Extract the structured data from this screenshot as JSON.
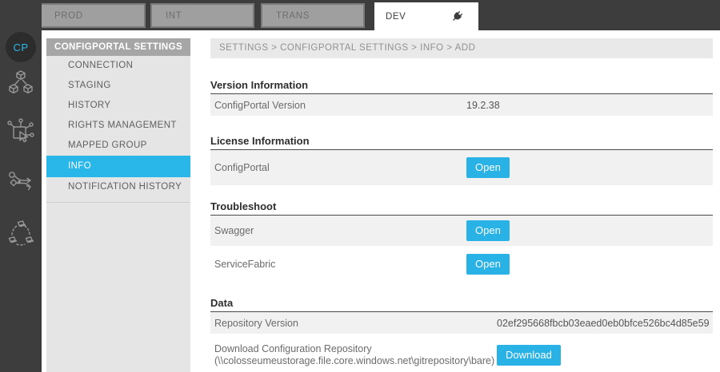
{
  "colors": {
    "accent": "#29b2e5",
    "topbar_dark": "#3d3d3d",
    "nav_selected": "#29b7ea",
    "tab_gray": "#9f9f9f",
    "row_shade": "#f1f1f1"
  },
  "sidebar": {
    "avatar_initials": "CP",
    "icons": [
      "cubes-icon",
      "touch-network-icon",
      "workflow-icon",
      "cluster-icon"
    ]
  },
  "tabs": [
    {
      "label": "PROD",
      "active": false
    },
    {
      "label": "INT",
      "active": false
    },
    {
      "label": "TRANS",
      "active": false
    },
    {
      "label": "DEV",
      "active": true,
      "icon": "plug-icon"
    }
  ],
  "nav": {
    "header": "CONFIGPORTAL SETTINGS",
    "items": [
      {
        "label": "CONNECTION",
        "selected": false
      },
      {
        "label": "STAGING",
        "selected": false
      },
      {
        "label": "HISTORY",
        "selected": false
      },
      {
        "label": "RIGHTS MANAGEMENT",
        "selected": false
      },
      {
        "label": "MAPPED GROUP",
        "selected": false
      },
      {
        "label": "INFO",
        "selected": true
      },
      {
        "label": "NOTIFICATION HISTORY",
        "selected": false
      }
    ]
  },
  "breadcrumb": "SETTINGS > CONFIGPORTAL SETTINGS > INFO > ADD",
  "sections": [
    {
      "title": "Version Information",
      "rows": [
        {
          "label": "ConfigPortal Version",
          "value": "19.2.38"
        }
      ]
    },
    {
      "title": "License Information",
      "rows": [
        {
          "label": "ConfigPortal",
          "button": "Open"
        }
      ]
    },
    {
      "title": "Troubleshoot",
      "rows": [
        {
          "label": "Swagger",
          "button": "Open"
        },
        {
          "label": "ServiceFabric",
          "button": "Open"
        }
      ]
    },
    {
      "title": "Data",
      "rows": [
        {
          "label": "Repository Version",
          "value": "02ef295668fbcb03eaed0eb0bfce526bc4d85e59"
        },
        {
          "label": "Download Configuration Repository",
          "sublabel": "(\\\\colosseumeustorage.file.core.windows.net\\gitrepository\\bare)",
          "button": "Download"
        }
      ]
    }
  ]
}
